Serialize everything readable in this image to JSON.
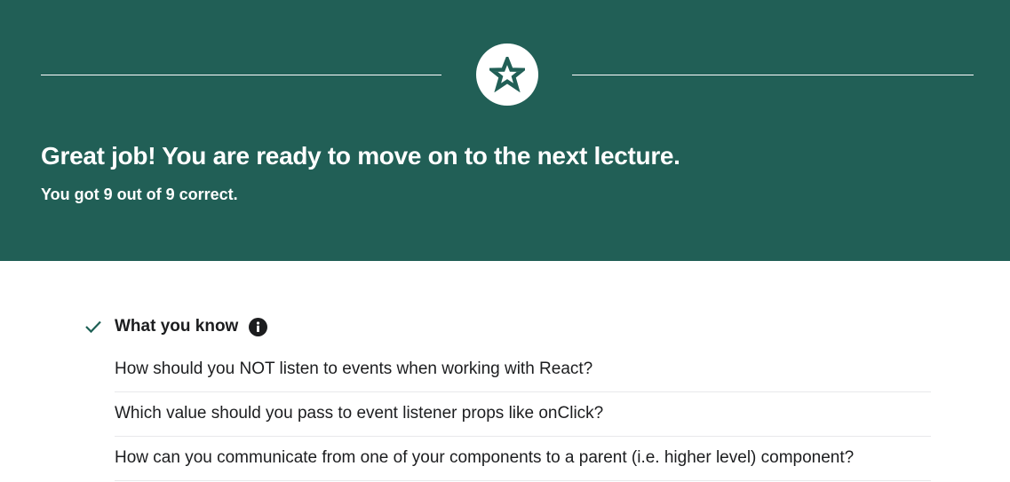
{
  "banner": {
    "icon": "star-icon",
    "headline": "Great job! You are ready to move on to the next lecture.",
    "score_text": "You got 9 out of 9 correct.",
    "background_color": "#215f56"
  },
  "what_you_know": {
    "check_icon": "checkmark-icon",
    "title": "What you know",
    "info_icon": "info-icon",
    "questions": [
      "How should you NOT listen to events when working with React?",
      "Which value should you pass to event listener props like onClick?",
      "How can you communicate from one of your components to a parent (i.e. higher level) component?"
    ]
  }
}
